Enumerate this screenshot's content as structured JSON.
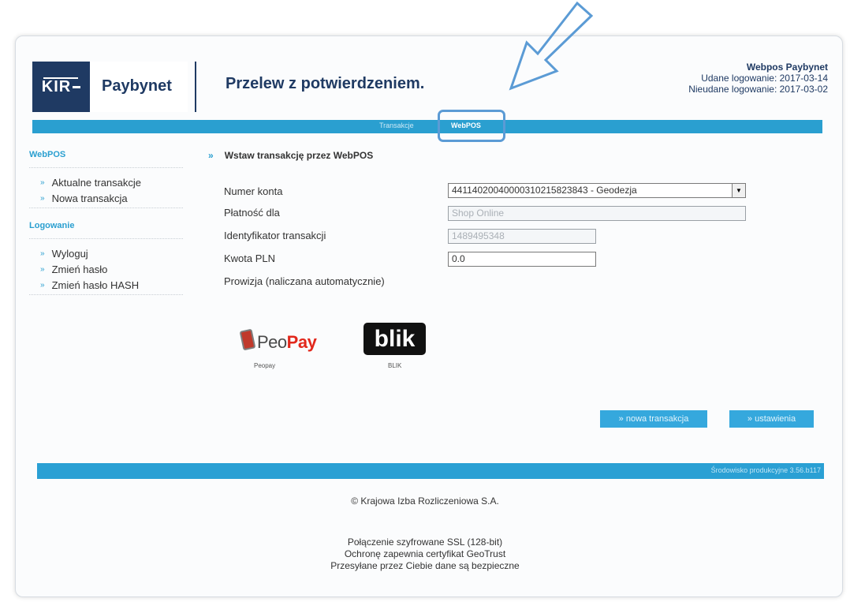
{
  "colors": {
    "accent": "#2a9fd0",
    "brand": "#1f3a63",
    "highlight": "#5b9bd5"
  },
  "header": {
    "logo_kir": "KIR",
    "logo_brand": "Paybynet",
    "title": "Przelew z potwierdzeniem.",
    "user_name": "Webpos Paybynet",
    "last_success_login": "Udane logowanie: 2017-03-14",
    "last_failed_login": "Nieudane logowanie: 2017-03-02"
  },
  "nav": {
    "items": [
      {
        "label": "Transakcje"
      },
      {
        "label": "WebPOS",
        "active": true
      }
    ]
  },
  "sidebar": {
    "section1": {
      "title": "WebPOS",
      "items": [
        {
          "label": "Aktualne transakcje"
        },
        {
          "label": "Nowa transakcja"
        }
      ]
    },
    "section2": {
      "title": "Logowanie",
      "items": [
        {
          "label": "Wyloguj"
        },
        {
          "label": "Zmień hasło"
        },
        {
          "label": "Zmień hasło HASH"
        }
      ]
    }
  },
  "main": {
    "section_title": "Wstaw transakcję przez WebPOS",
    "form": {
      "account_label": "Numer konta",
      "account_value": "44114020040000310215823843 - Geodezja",
      "payee_label": "Płatność dla",
      "payee_value": "Shop Online",
      "txid_label": "Identyfikator transakcji",
      "txid_value": "1489495348",
      "amount_label": "Kwota PLN",
      "amount_value": "0.0",
      "fee_label": "Prowizja (naliczana automatycznie)"
    },
    "payment_methods": [
      {
        "name": "Peopay",
        "logo_text_a": "Peo",
        "logo_text_b": "Pay",
        "icon": "peopay-logo"
      },
      {
        "name": "BLIK",
        "logo_text": "blik",
        "icon": "blik-logo"
      }
    ],
    "buttons": {
      "new_transaction": "» nowa transakcja",
      "settings": "» ustawienia"
    }
  },
  "footer": {
    "environment": "Środowisko produkcyjne 3.56.b117",
    "copyright": "© Krajowa Izba Rozliczeniowa S.A.",
    "ssl_line1": "Połączenie szyfrowane SSL (128-bit)",
    "ssl_line2": "Ochronę zapewnia certyfikat GeoTrust",
    "ssl_line3": "Przesyłane przez Ciebie dane są bezpieczne"
  }
}
